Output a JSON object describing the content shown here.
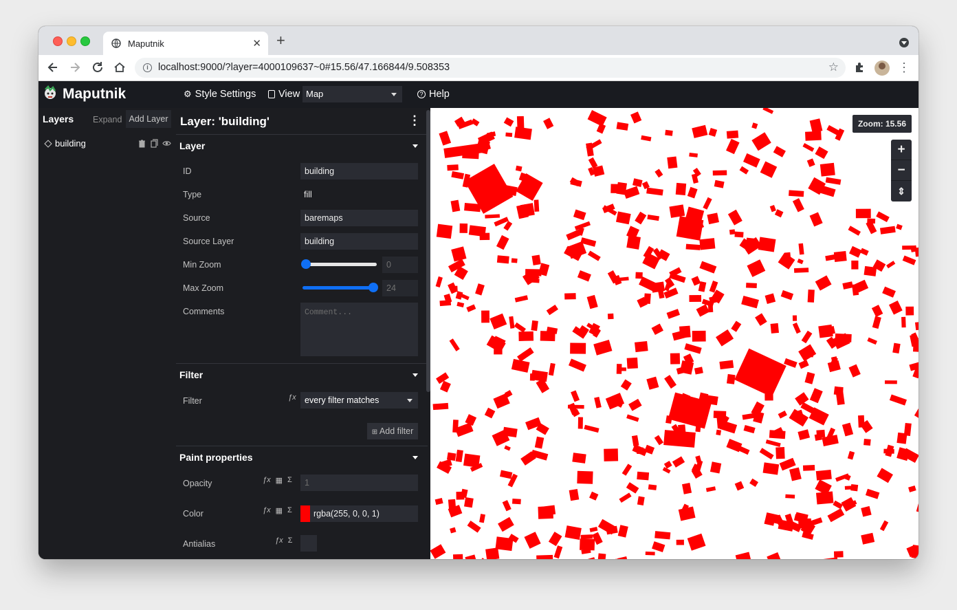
{
  "browser": {
    "tab_title": "Maputnik",
    "tab_close": "✕",
    "new_tab": "+",
    "url": "localhost:9000/?layer=4000109637~0#15.56/47.166844/9.508353"
  },
  "header": {
    "brand": "Maputnik",
    "style_settings": "Style Settings",
    "view_label": "View",
    "view_value": "Map",
    "help": "Help"
  },
  "layers_panel": {
    "title": "Layers",
    "expand": "Expand",
    "add_layer": "Add Layer",
    "items": [
      {
        "name": "building"
      }
    ]
  },
  "editor": {
    "title": "Layer: 'building'",
    "sections": {
      "layer": "Layer",
      "filter": "Filter",
      "paint": "Paint properties"
    },
    "fields": {
      "id_label": "ID",
      "id_value": "building",
      "type_label": "Type",
      "type_value": "fill",
      "source_label": "Source",
      "source_value": "baremaps",
      "source_layer_label": "Source Layer",
      "source_layer_value": "building",
      "min_zoom_label": "Min Zoom",
      "min_zoom_value": "0",
      "max_zoom_label": "Max Zoom",
      "max_zoom_value": "24",
      "comments_label": "Comments",
      "comments_placeholder": "Comment..."
    },
    "filter": {
      "label": "Filter",
      "value": "every filter matches",
      "add_filter": "Add filter"
    },
    "paint": {
      "opacity_label": "Opacity",
      "opacity_value": "1",
      "color_label": "Color",
      "color_value": "rgba(255, 0, 0, 1)",
      "antialias_label": "Antialias"
    }
  },
  "map": {
    "zoom_badge": "Zoom: 15.56",
    "zoom_in": "+",
    "zoom_out": "−",
    "compass": "⇕",
    "building_color": "#ff0000"
  },
  "colors": {
    "app_bg": "#1c1d21",
    "accent": "#0f6ff5",
    "building": "#ff0000"
  }
}
